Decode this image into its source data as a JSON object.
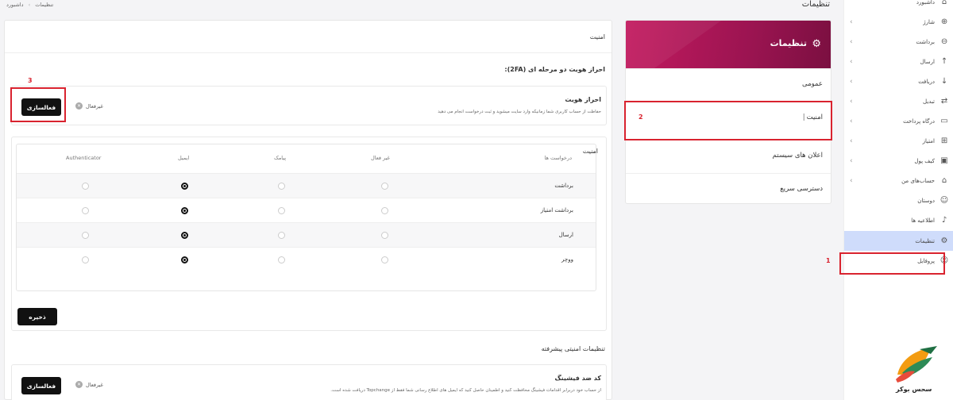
{
  "breadcrumb": {
    "home": "داشبورد",
    "separator": "›",
    "current": "تنظیمات"
  },
  "page_title": "تنظیمات",
  "sidebar": {
    "items": [
      {
        "label": "داشبورد",
        "icon": "home-icon",
        "has_chevron": false
      },
      {
        "label": "شارژ",
        "icon": "plus-circle-icon",
        "has_chevron": true
      },
      {
        "label": "برداشت",
        "icon": "minus-circle-icon",
        "has_chevron": true
      },
      {
        "label": "ارسال",
        "icon": "arrow-up-circle-icon",
        "has_chevron": true
      },
      {
        "label": "دریافت",
        "icon": "arrow-down-circle-icon",
        "has_chevron": true
      },
      {
        "label": "تبدیل",
        "icon": "exchange-icon",
        "has_chevron": true
      },
      {
        "label": "درگاه پرداخت",
        "icon": "credit-card-icon",
        "has_chevron": true
      },
      {
        "label": "امتیاز",
        "icon": "gift-icon",
        "has_chevron": true
      },
      {
        "label": "کیف پول",
        "icon": "wallet-icon",
        "has_chevron": true
      },
      {
        "label": "حساب‌های من",
        "icon": "bank-icon",
        "has_chevron": true
      },
      {
        "label": "دوستان",
        "icon": "users-icon",
        "has_chevron": false
      },
      {
        "label": "اطلاعیه ها",
        "icon": "bell-icon",
        "has_chevron": false
      },
      {
        "label": "تنظیمات",
        "icon": "gear-icon",
        "has_chevron": false,
        "active": true
      },
      {
        "label": "پروفایل",
        "icon": "user-icon",
        "has_chevron": false
      }
    ],
    "logo_text": "سحس بوکر"
  },
  "settings_nav": {
    "header_title": "تنظیمات",
    "items": [
      "عمومی",
      "امنیت",
      "اعلان های سیستم",
      "دسترسی سریع"
    ]
  },
  "main": {
    "card_title": "امنیت",
    "twofa_heading": "احراز هویت دو مرحله ای (2FA):",
    "twofa": {
      "title": "احراز هویت",
      "description": "حفاظت از حساب کاربری شما زمانیکه وارد سایت میشوید و ثبت درخواست انجام می دهید",
      "status": "غیرفعال",
      "button": "فعالسازی"
    },
    "security_table": {
      "title": "امنیت",
      "columns": [
        "درخواست ها",
        "غیر فعال",
        "پیامک",
        "ایمیل",
        "Authenticator"
      ],
      "rows": [
        {
          "label": "برداشت",
          "selected": "ایمیل"
        },
        {
          "label": "برداشت امتیاز",
          "selected": "ایمیل"
        },
        {
          "label": "ارسال",
          "selected": "ایمیل"
        },
        {
          "label": "ووچر",
          "selected": "ایمیل"
        }
      ],
      "save_button": "ذخیره"
    },
    "advanced_heading": "تنظیمات امنیتی پیشرفته",
    "antiphishing": {
      "title": "کد ضد فیشینگ",
      "description": "از حساب خود دربرابر اقدامات فیشینگ محافظت کنید و اطمینان حاصل کنید که ایمیل های اطلاع رسانی شما فقط از Topchange دریافت شده است.",
      "status": "غیرفعال",
      "button": "فعالسازی"
    }
  },
  "annotations": [
    "1",
    "2",
    "3"
  ],
  "colors": {
    "accent": "#c31a5f",
    "highlight_box": "#d9232f",
    "active_bg": "#cfdcfb"
  }
}
